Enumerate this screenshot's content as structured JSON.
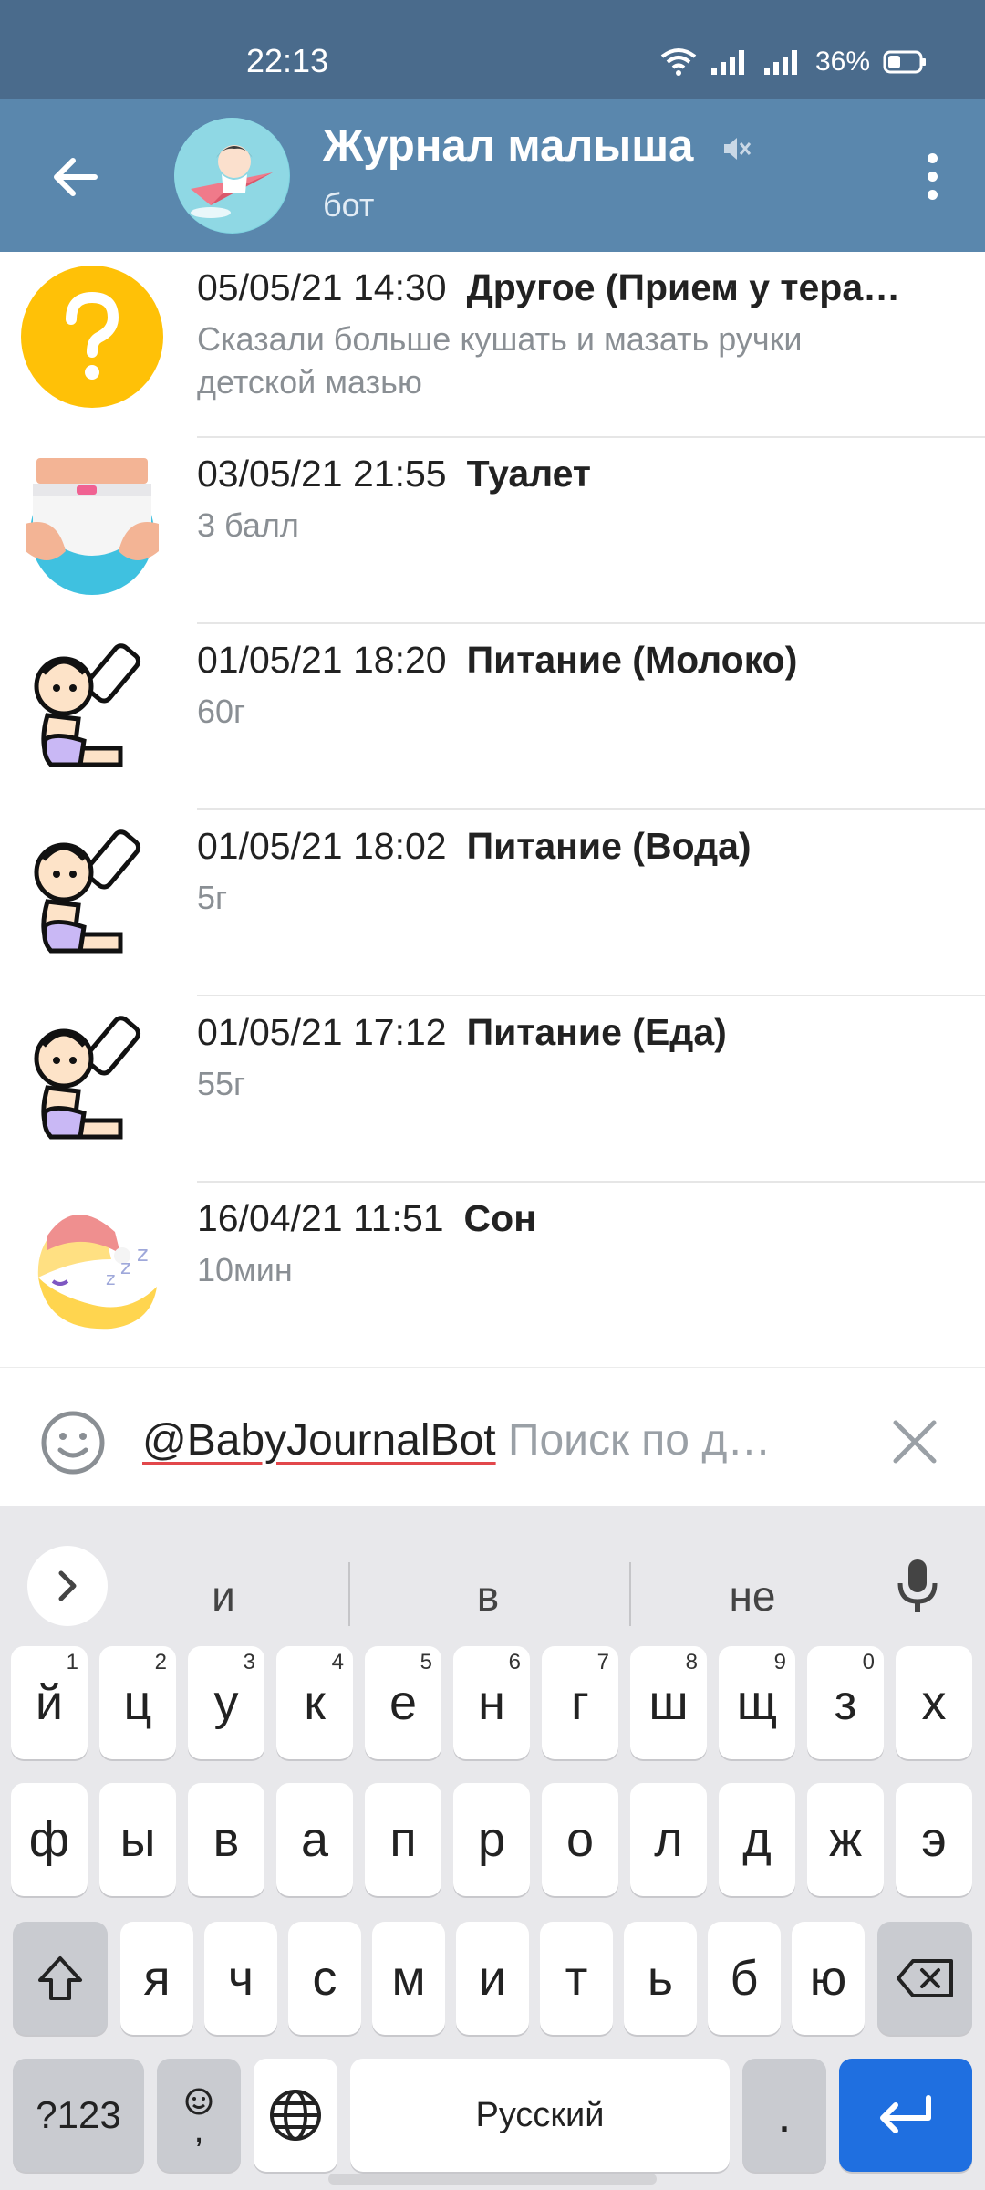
{
  "status_bar": {
    "time": "22:13",
    "battery": "36%"
  },
  "header": {
    "title": "Журнал малыша",
    "subtitle": "бот"
  },
  "results": [
    {
      "datetime": "05/05/21 14:30",
      "category": "Другое (Прием у тера…",
      "detail": "Сказали больше кушать и мазать ручки детской мазью",
      "icon": "question-icon"
    },
    {
      "datetime": "03/05/21 21:55",
      "category": "Туалет",
      "detail": "3 балл",
      "icon": "diaper-icon"
    },
    {
      "datetime": "01/05/21 18:20",
      "category": "Питание (Молоко)",
      "detail": "60г",
      "icon": "baby-bottle-icon"
    },
    {
      "datetime": "01/05/21 18:02",
      "category": "Питание (Вода)",
      "detail": "5г",
      "icon": "baby-bottle-icon"
    },
    {
      "datetime": "01/05/21 17:12",
      "category": "Питание (Еда)",
      "detail": "55г",
      "icon": "baby-bottle-icon"
    },
    {
      "datetime": "16/04/21 11:51",
      "category": "Сон",
      "detail": "10мин",
      "icon": "moon-sleep-icon"
    }
  ],
  "input": {
    "value": "@BabyJournalBot",
    "placeholder": "Поиск по д…"
  },
  "keyboard": {
    "suggestions": [
      "и",
      "в",
      "не"
    ],
    "row1": [
      "й",
      "ц",
      "у",
      "к",
      "е",
      "н",
      "г",
      "ш",
      "щ",
      "з",
      "х"
    ],
    "row1_hints": [
      "1",
      "2",
      "3",
      "4",
      "5",
      "6",
      "7",
      "8",
      "9",
      "0",
      ""
    ],
    "row2": [
      "ф",
      "ы",
      "в",
      "а",
      "п",
      "р",
      "о",
      "л",
      "д",
      "ж",
      "э"
    ],
    "row3": [
      "я",
      "ч",
      "с",
      "м",
      "и",
      "т",
      "ь",
      "б",
      "ю"
    ],
    "symbols_label": "?123",
    "comma_label": ",",
    "space_label": "Русский",
    "period_label": "."
  }
}
